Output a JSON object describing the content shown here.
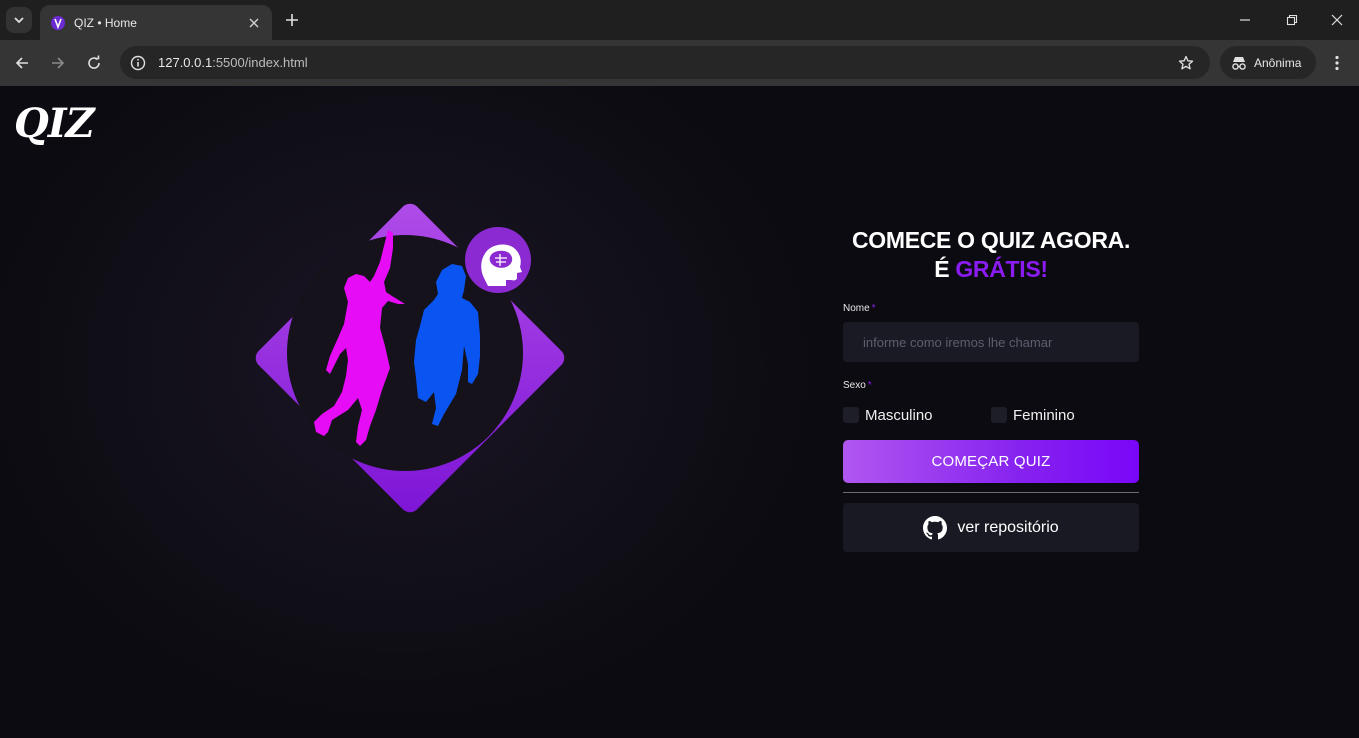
{
  "browser": {
    "tab_title": "QIZ • Home",
    "url_host": "127.0.0.1",
    "url_rest": ":5500/index.html",
    "incognito_label": "Anônima"
  },
  "page": {
    "logo": "QIZ",
    "headline_line1": "COMECE O QUIZ AGORA.",
    "headline_line2_prefix": "É ",
    "headline_line2_accent": "GRÁTIS!",
    "name_label": "Nome",
    "name_placeholder": "informe como iremos lhe chamar",
    "required_mark": "*",
    "sex_label": "Sexo",
    "sex_options": [
      "Masculino",
      "Feminino"
    ],
    "start_button": "COMEÇAR QUIZ",
    "repo_button": "ver repositório"
  },
  "colors": {
    "accent": "#8a1cf2",
    "female_figure": "#e60cf5",
    "male_figure": "#0a55f2",
    "background": "#0c0b11"
  }
}
